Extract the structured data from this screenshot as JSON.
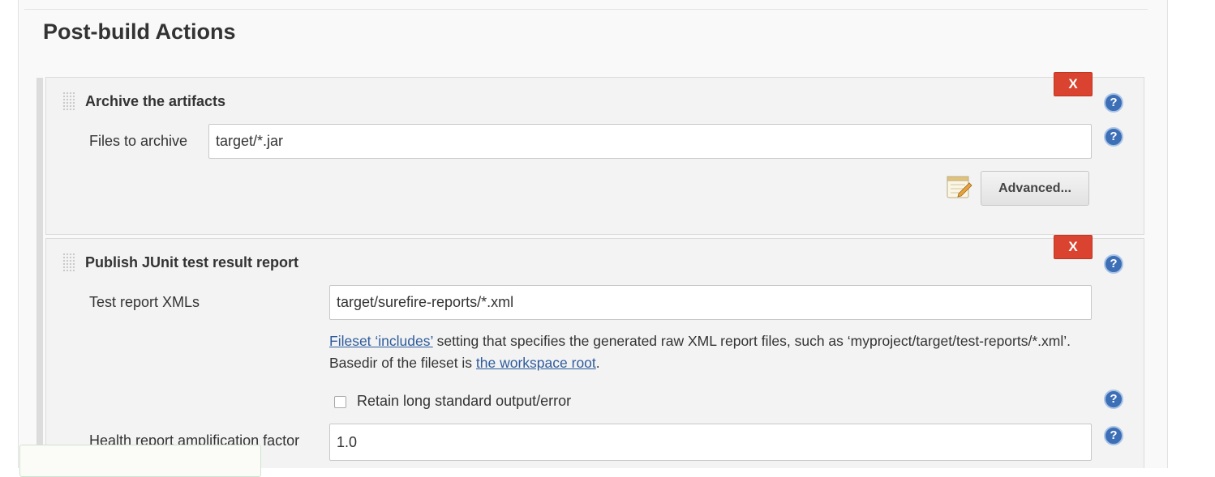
{
  "section": {
    "title": "Post-build Actions"
  },
  "archive": {
    "title": "Archive the artifacts",
    "delete_label": "X",
    "files_label": "Files to archive",
    "files_value": "target/*.jar",
    "advanced_label": "Advanced..."
  },
  "junit": {
    "title": "Publish JUnit test result report",
    "delete_label": "X",
    "xmls_label": "Test report XMLs",
    "xmls_value": "target/surefire-reports/*.xml",
    "desc_link1": "Fileset ‘includes’",
    "desc_text1": " setting that specifies the generated raw XML report files, such as ‘myproject/target/test-reports/*.xml’. Basedir of the fileset is ",
    "desc_link2": "the workspace root",
    "desc_text2": ".",
    "retain_label": "Retain long standard output/error",
    "health_label": "Health report amplification factor",
    "health_value": "1.0"
  },
  "help_glyph": "?",
  "icons": {
    "help": "help-circle-icon",
    "notepad": "notepad-icon",
    "grip": "drag-handle-icon"
  },
  "colors": {
    "delete": "#d9432f",
    "help": "#3d6fb6",
    "link": "#2f5c9c"
  }
}
